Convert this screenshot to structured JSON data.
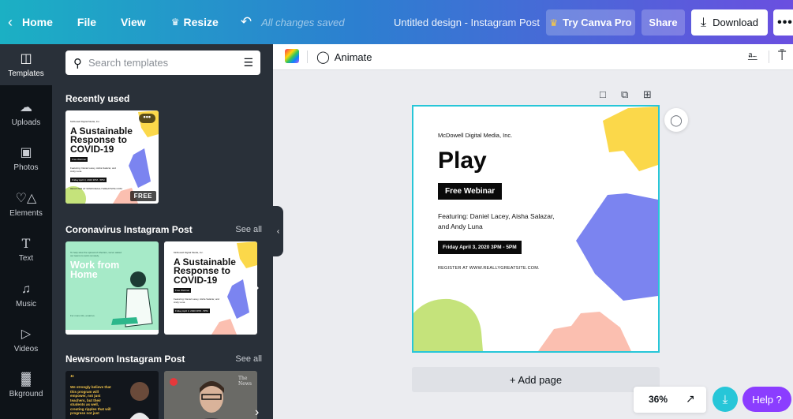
{
  "topbar": {
    "home_label": "Home",
    "file_label": "File",
    "view_label": "View",
    "resize_label": "Resize",
    "saved_status": "All changes saved",
    "doc_title": "Untitled design - Instagram Post",
    "try_pro_label": "Try Canva Pro",
    "share_label": "Share",
    "download_label": "Download",
    "more_label": "•••",
    "gradient_colors": [
      "#1bb0c4",
      "#2c7fd0",
      "#6a4fe0"
    ]
  },
  "rail": {
    "items": [
      {
        "label": "Templates",
        "icon": "layout-icon",
        "active": true
      },
      {
        "label": "Uploads",
        "icon": "cloud-upload-icon",
        "active": false
      },
      {
        "label": "Photos",
        "icon": "image-icon",
        "active": false
      },
      {
        "label": "Elements",
        "icon": "shapes-icon",
        "active": false
      },
      {
        "label": "Text",
        "icon": "text-icon",
        "active": false
      },
      {
        "label": "Music",
        "icon": "music-icon",
        "active": false
      },
      {
        "label": "Videos",
        "icon": "video-icon",
        "active": false
      },
      {
        "label": "Bkground",
        "icon": "background-icon",
        "active": false
      }
    ]
  },
  "panel": {
    "search_placeholder": "Search templates",
    "sections": [
      {
        "title": "Recently used",
        "see_all": ""
      },
      {
        "title": "Coronavirus Instagram Post",
        "see_all": "See all"
      },
      {
        "title": "Newsroom Instagram Post",
        "see_all": "See all"
      }
    ],
    "recent_thumb": {
      "company": "McDowell Digital Media, Inc.",
      "title": "A Sustainable Response to COVID-19",
      "badge": "FREE",
      "more": "•••"
    },
    "corona_thumbs": [
      {
        "title": "Work from Home"
      },
      {
        "title": "A Sustainable Response to COVID-19",
        "company": "McDowell Digital Media, Inc."
      }
    ],
    "news_thumbs": [
      {
        "quote": "We strongly believe that this program will empower, not just teachers, but their students as well, creating ripples that will progress not just"
      },
      {
        "logo": "The News"
      }
    ]
  },
  "editbar": {
    "animate_label": "Animate"
  },
  "design": {
    "company": "McDowell Digital Media, Inc.",
    "title": "Play",
    "webinar": "Free Webinar",
    "featuring": "Featuring: Daniel Lacey, Aisha Salazar, and Andy Luna",
    "date": "Friday April 3, 2020 3PM - 5PM",
    "register": "REGISTER AT WWW.REALLYGREATSITE.COM.",
    "border_color": "#27c6d8",
    "shape_colors": {
      "yellow": "#fbd84a",
      "blue": "#7b84f0",
      "green": "#c5e37b",
      "pink": "#fbbfb0"
    }
  },
  "canvas": {
    "add_page_label": "+ Add page"
  },
  "footer": {
    "zoom": "36%",
    "help_label": "Help ?"
  }
}
